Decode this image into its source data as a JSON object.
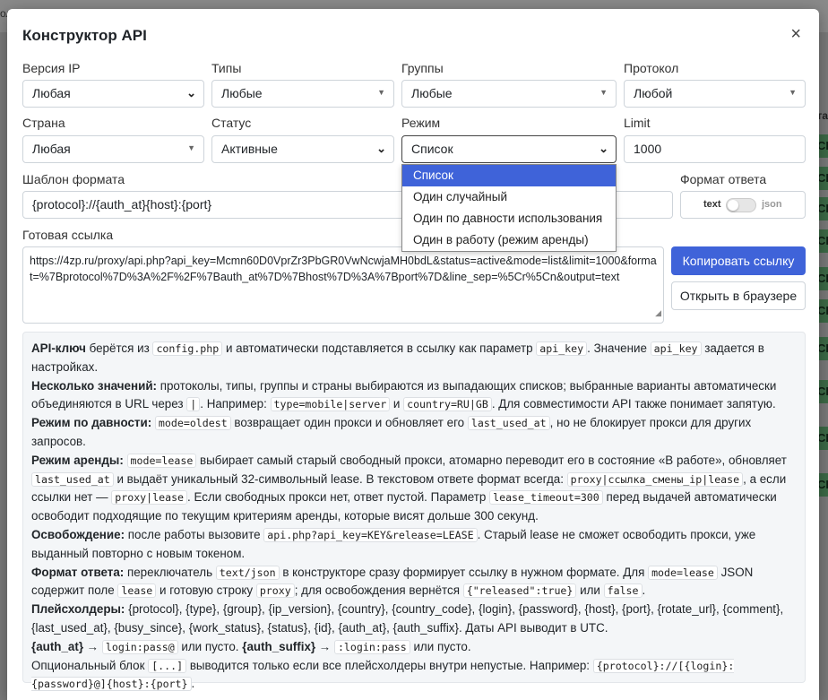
{
  "background": {
    "top_tab": "ол",
    "right_header": "та",
    "right_cells": [
      "CB",
      "CB",
      "CB",
      "CB",
      "CB",
      "CB",
      "CB",
      "CB",
      "CB",
      "CB"
    ]
  },
  "modal": {
    "title": "Конструктор API",
    "close_label": "×"
  },
  "fields": {
    "ip_version": {
      "label": "Версия IP",
      "value": "Любая"
    },
    "types": {
      "label": "Типы",
      "value": "Любые"
    },
    "groups": {
      "label": "Группы",
      "value": "Любые"
    },
    "protocol": {
      "label": "Протокол",
      "value": "Любой"
    },
    "country": {
      "label": "Страна",
      "value": "Любая"
    },
    "status": {
      "label": "Статус",
      "value": "Активные"
    },
    "mode": {
      "label": "Режим",
      "value": "Список"
    },
    "limit": {
      "label": "Limit",
      "value": "1000"
    },
    "format_template": {
      "label": "Шаблон формата",
      "value": "{protocol}://{auth_at}{host}:{port}"
    },
    "response_format": {
      "label": "Формат ответа",
      "text": "text",
      "json": "json"
    },
    "ready_link": {
      "label": "Готовая ссылка",
      "value": "https://4zp.ru/proxy/api.php?api_key=Mcmn60D0VprZr3PbGR0VwNcwjaMH0bdL&status=active&mode=list&limit=1000&format=%7Bprotocol%7D%3A%2F%2F%7Bauth_at%7D%7Bhost%7D%3A%7Bport%7D&line_sep=%5Cr%5Cn&output=text"
    }
  },
  "mode_options": [
    "Список",
    "Один случайный",
    "Один по давности использования",
    "Один в работу (режим аренды)"
  ],
  "buttons": {
    "copy": "Копировать ссылку",
    "open": "Открыть в браузере"
  },
  "help": {
    "p1": {
      "b": "API-ключ",
      "t1": " берётся из ",
      "c1": "config.php",
      "t2": " и автоматически подставляется в ссылку как параметр ",
      "c2": "api_key",
      "t3": ". Значение ",
      "c3": "api_key",
      "t4": " задается в настройках."
    },
    "p2": {
      "b": "Несколько значений:",
      "t1": " протоколы, типы, группы и страны выбираются из выпадающих списков; выбранные варианты автоматически объединяются в URL через ",
      "c1": "|",
      "t2": ". Например: ",
      "c2": "type=mobile|server",
      "t3": " и ",
      "c3": "country=RU|GB",
      "t4": ". Для совместимости API также понимает запятую."
    },
    "p3": {
      "b": "Режим по давности:",
      "t1": " ",
      "c1": "mode=oldest",
      "t2": " возвращает один прокси и обновляет его ",
      "c2": "last_used_at",
      "t3": ", но не блокирует прокси для других запросов."
    },
    "p4": {
      "b": "Режим аренды:",
      "t1": " ",
      "c1": "mode=lease",
      "t2": " выбирает самый старый свободный прокси, атомарно переводит его в состояние «В работе», обновляет ",
      "c2": "last_used_at",
      "t3": " и выдаёт уникальный 32-символьный lease. В текстовом ответе формат всегда: ",
      "c3": "proxy|ссылка_смены_ip|lease",
      "t4": ", а если ссылки нет — ",
      "c4": "proxy|lease",
      "t5": ". Если свободных прокси нет, ответ пустой. Параметр ",
      "c5": "lease_timeout=300",
      "t6": " перед выдачей автоматически освободит подходящие по текущим критериям аренды, которые висят дольше 300 секунд."
    },
    "p5": {
      "b": "Освобождение:",
      "t1": " после работы вызовите ",
      "c1": "api.php?api_key=KEY&release=LEASE",
      "t2": ". Старый lease не сможет освободить прокси, уже выданный повторно с новым токеном."
    },
    "p6": {
      "b": "Формат ответа:",
      "t1": " переключатель ",
      "c1": "text/json",
      "t2": " в конструкторе сразу формирует ссылку в нужном формате. Для ",
      "c2": "mode=lease",
      "t3": " JSON содержит поле ",
      "c3": "lease",
      "t4": " и готовую строку ",
      "c4": "proxy",
      "t5": "; для освобождения вернётся ",
      "c5": "{\"released\":true}",
      "t6": " или ",
      "c6": "false",
      "t7": "."
    },
    "p7": {
      "b": "Плейсхолдеры:",
      "t1": " {protocol}, {type}, {group}, {ip_version}, {country}, {country_code}, {login}, {password}, {host}, {port}, {rotate_url}, {comment}, {last_used_at}, {busy_since}, {work_status}, {status}, {id}, {auth_at}, {auth_suffix}. Даты API выводит в UTC."
    },
    "p8": {
      "b1": "{auth_at}",
      "t1": " → ",
      "c1": "login:pass@",
      "t2": " или пусто. ",
      "b2": "{auth_suffix}",
      "t3": " → ",
      "c2": ":login:pass",
      "t4": " или пусто."
    },
    "p9": {
      "t1": "Опциональный блок ",
      "c1": "[...]",
      "t2": " выводится только если все плейсхолдеры внутри непустые. Например: ",
      "c2": "{protocol}://[{login}:{password}@]{host}:{port}",
      "t3": "."
    }
  }
}
